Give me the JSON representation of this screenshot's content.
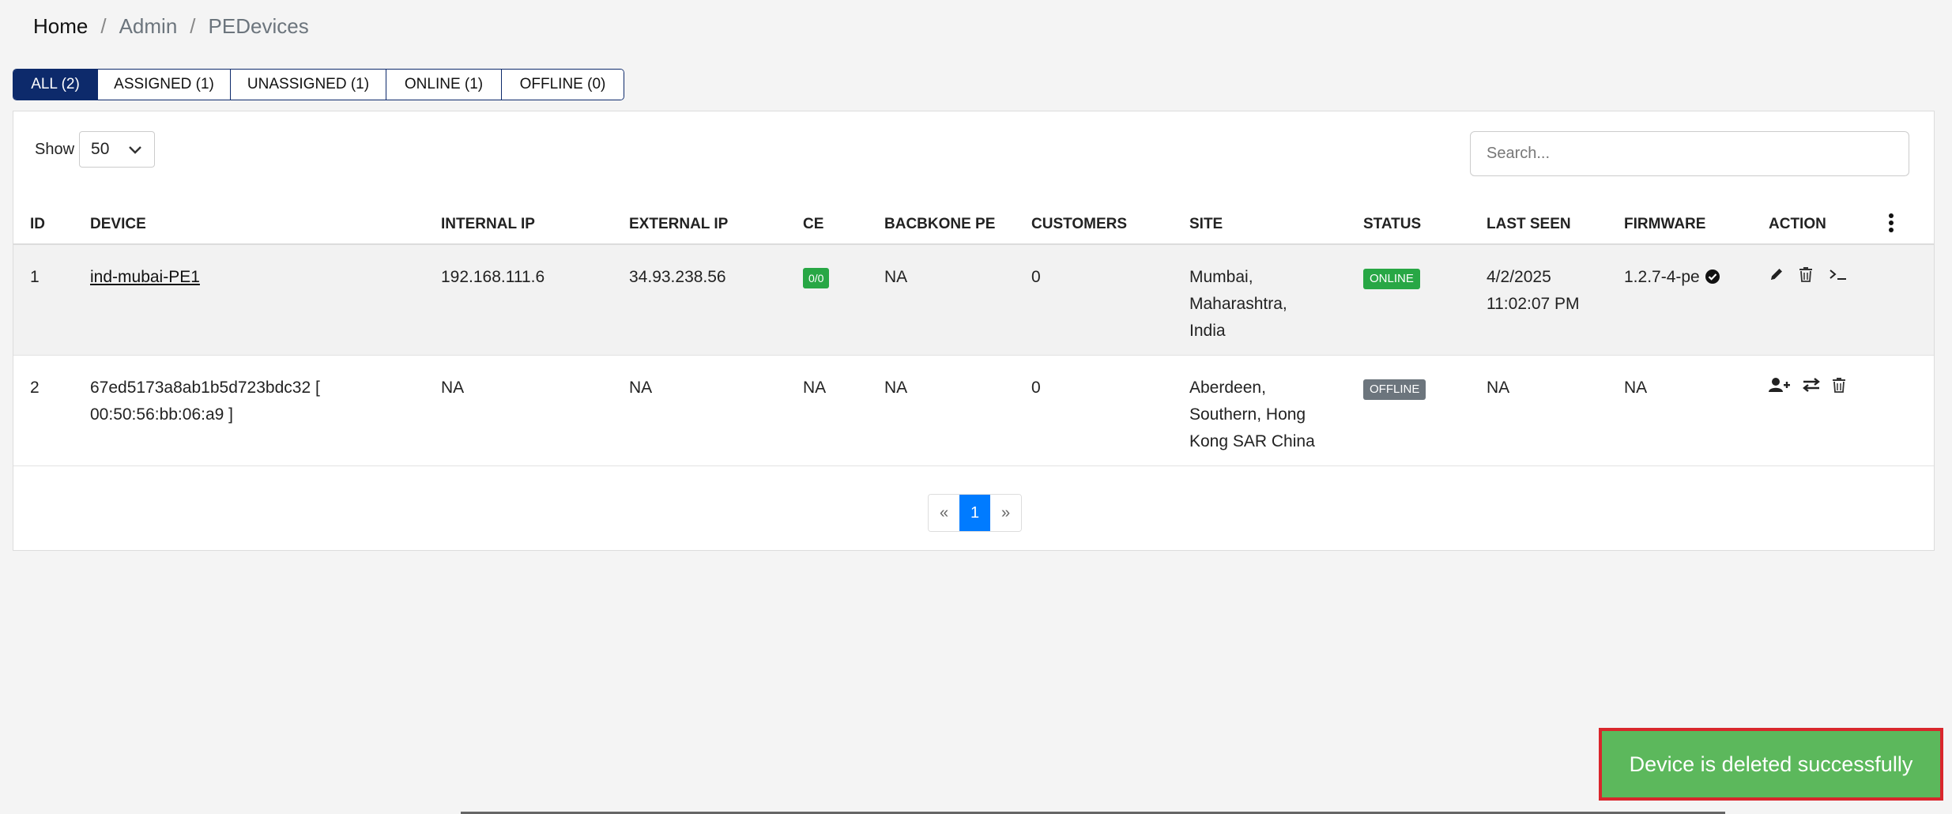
{
  "breadcrumb": {
    "home": "Home",
    "admin": "Admin",
    "current": "PEDevices",
    "separator": "/"
  },
  "tabs": [
    {
      "label": "ALL (2)",
      "active": true
    },
    {
      "label": "ASSIGNED (1)",
      "active": false
    },
    {
      "label": "UNASSIGNED (1)",
      "active": false
    },
    {
      "label": "ONLINE (1)",
      "active": false
    },
    {
      "label": "OFFLINE (0)",
      "active": false
    }
  ],
  "show": {
    "label": "Show",
    "value": "50"
  },
  "search": {
    "placeholder": "Search..."
  },
  "table": {
    "headers": {
      "id": "ID",
      "device": "DEVICE",
      "internal_ip": "INTERNAL IP",
      "external_ip": "EXTERNAL IP",
      "ce": "CE",
      "backbone_pe": "BACBKONE PE",
      "customers": "CUSTOMERS",
      "site": "SITE",
      "status": "STATUS",
      "last_seen": "LAST SEEN",
      "firmware": "FIRMWARE",
      "action": "ACTION"
    },
    "rows": [
      {
        "id": "1",
        "device": "ind-mubai-PE1",
        "internal_ip": "192.168.111.6",
        "external_ip": "34.93.238.56",
        "ce": "0/0",
        "backbone_pe": "NA",
        "customers": "0",
        "site_l1": "Mumbai,",
        "site_l2": "Maharashtra,",
        "site_l3": "India",
        "status": "ONLINE",
        "last_seen_l1": "4/2/2025",
        "last_seen_l2": "11:02:07 PM",
        "firmware": "1.2.7-4-pe"
      },
      {
        "id": "2",
        "device_l1": "67ed5173a8ab1b5d723bdc32 [",
        "device_l2": "00:50:56:bb:06:a9 ]",
        "internal_ip": "NA",
        "external_ip": "NA",
        "ce": "NA",
        "backbone_pe": "NA",
        "customers": "0",
        "site_l1": "Aberdeen,",
        "site_l2": "Southern, Hong",
        "site_l3": "Kong SAR China",
        "status": "OFFLINE",
        "last_seen": "NA",
        "firmware": "NA"
      }
    ]
  },
  "pagination": {
    "prev": "«",
    "current": "1",
    "next": "»"
  },
  "toast": {
    "message": "Device is deleted successfully"
  },
  "colors": {
    "primary_navy": "#0d2a6b",
    "online": "#28a745",
    "offline": "#6c757d",
    "toast_bg": "#5cb85c",
    "toast_border": "#d9262c",
    "page_active": "#007bff"
  }
}
